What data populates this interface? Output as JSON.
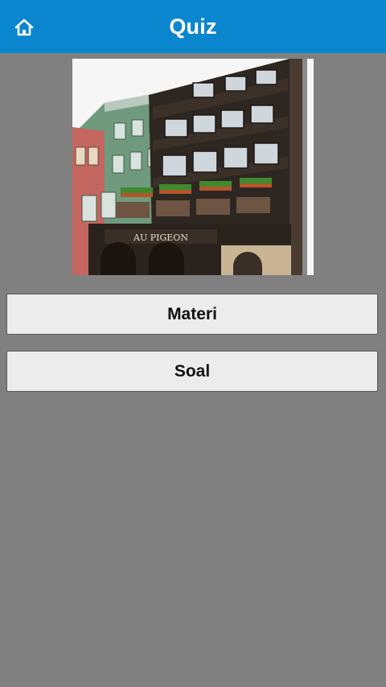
{
  "header": {
    "title": "Quiz",
    "home_icon": "home-icon",
    "background_color": "#0a86cf"
  },
  "image": {
    "signage_text": "AU PIGEON"
  },
  "menu": {
    "materi_label": "Materi",
    "soal_label": "Soal"
  },
  "colors": {
    "page_background": "#808080",
    "button_background": "#ececec"
  }
}
